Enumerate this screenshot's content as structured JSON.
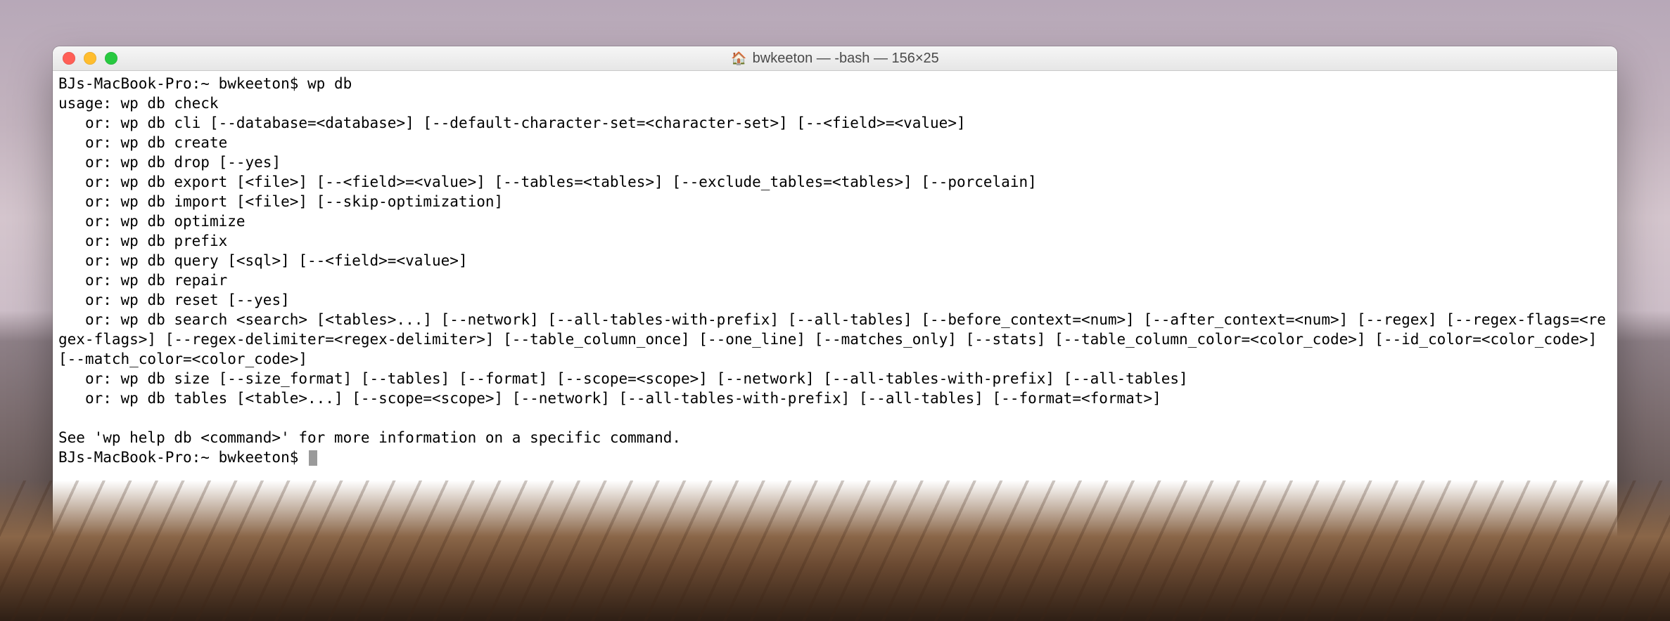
{
  "window": {
    "title_icon": "🏠",
    "title": "bwkeeton — -bash — 156×25"
  },
  "terminal": {
    "prompt1": "BJs-MacBook-Pro:~ bwkeeton$ ",
    "command1": "wp db",
    "output": "usage: wp db check\n   or: wp db cli [--database=<database>] [--default-character-set=<character-set>] [--<field>=<value>]\n   or: wp db create\n   or: wp db drop [--yes]\n   or: wp db export [<file>] [--<field>=<value>] [--tables=<tables>] [--exclude_tables=<tables>] [--porcelain]\n   or: wp db import [<file>] [--skip-optimization]\n   or: wp db optimize\n   or: wp db prefix\n   or: wp db query [<sql>] [--<field>=<value>]\n   or: wp db repair\n   or: wp db reset [--yes]\n   or: wp db search <search> [<tables>...] [--network] [--all-tables-with-prefix] [--all-tables] [--before_context=<num>] [--after_context=<num>] [--regex] [--regex-flags=<regex-flags>] [--regex-delimiter=<regex-delimiter>] [--table_column_once] [--one_line] [--matches_only] [--stats] [--table_column_color=<color_code>] [--id_color=<color_code>] [--match_color=<color_code>]\n   or: wp db size [--size_format] [--tables] [--format] [--scope=<scope>] [--network] [--all-tables-with-prefix] [--all-tables]\n   or: wp db tables [<table>...] [--scope=<scope>] [--network] [--all-tables-with-prefix] [--all-tables] [--format=<format>]\n\nSee 'wp help db <command>' for more information on a specific command.",
    "prompt2": "BJs-MacBook-Pro:~ bwkeeton$ "
  }
}
